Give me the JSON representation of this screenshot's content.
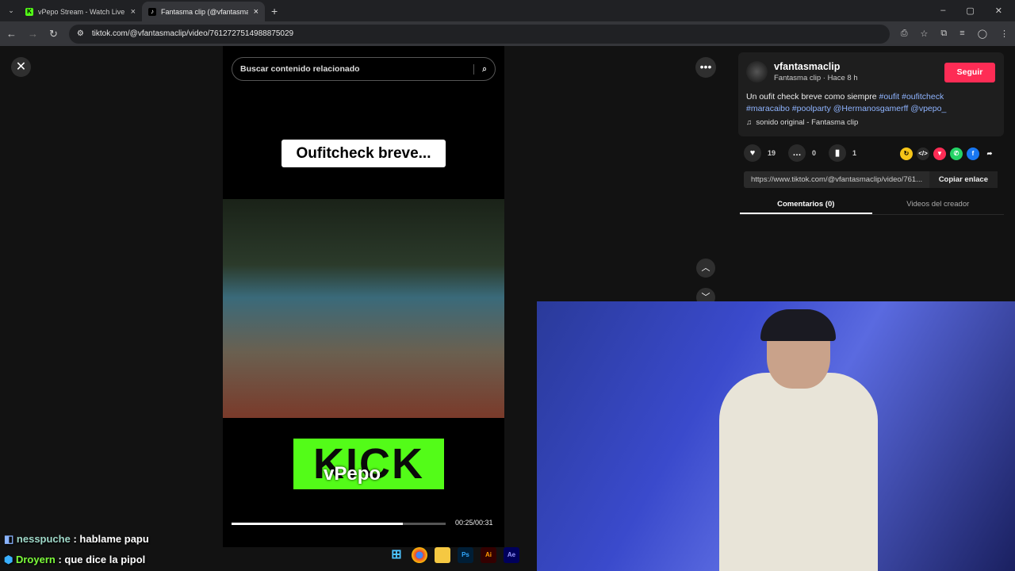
{
  "browser": {
    "tabs": [
      {
        "title": "vPepo Stream - Watch Live on Kick",
        "icon": "K"
      },
      {
        "title": "Fantasma clip (@vfantasmaclip)",
        "icon": "♪"
      }
    ],
    "url": "tiktok.com/@vfantasmaclip/video/7612727514988875029"
  },
  "video": {
    "search_placeholder": "Buscar contenido relacionado",
    "caption": "Oufitcheck breve...",
    "logo_text": "KICK",
    "logo_sub": "vPepo",
    "progress": 0.8,
    "time": "00:25/00:31"
  },
  "post": {
    "username": "vfantasmaclip",
    "subtitle": "Fantasma clip · Hace 8 h",
    "follow": "Seguir",
    "desc_text": "Un oufit check breve como siempre ",
    "tags": [
      "#oufit",
      "#oufitcheck",
      "#maracaibo",
      "#poolparty",
      "@Hermanosgamerff",
      "@vpepo_"
    ],
    "sound": "sonido original - Fantasma clip",
    "likes": "19",
    "comments": "0",
    "saves": "1",
    "link": "https://www.tiktok.com/@vfantasmaclip/video/761...",
    "copy": "Copiar enlace",
    "tab_comments": "Comentarios (0)",
    "tab_videos": "Videos del creador"
  },
  "chat": [
    {
      "user": "nesspuche",
      "msg": ": hablame papu",
      "color": "#9fd8c8"
    },
    {
      "user": "Droyern",
      "msg": ": que dice la pipol",
      "color": "#7cfc3a"
    }
  ],
  "taskbar": {
    "ps": "Ps",
    "ai": "Ai",
    "ae": "Ae"
  }
}
